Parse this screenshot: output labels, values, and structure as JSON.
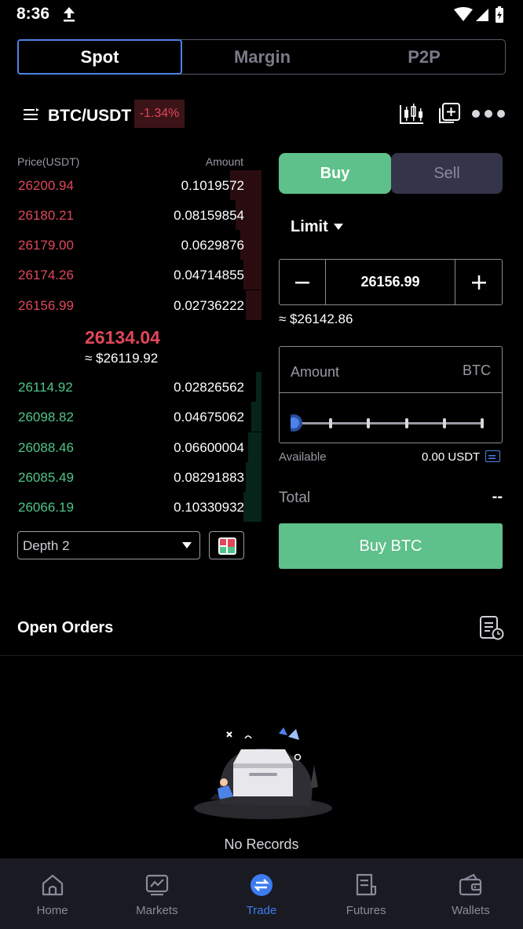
{
  "status_bar": {
    "time": "8:36"
  },
  "segment_tabs": [
    {
      "label": "Spot",
      "active": true
    },
    {
      "label": "Margin",
      "active": false
    },
    {
      "label": "P2P",
      "active": false
    }
  ],
  "pair": {
    "name": "BTC/USDT",
    "change": "-1.34%"
  },
  "orderbook": {
    "price_header": "Price(USDT)",
    "amount_header": "Amount",
    "asks": [
      {
        "price": "26200.94",
        "amount": "0.1019572",
        "depth": 0.12
      },
      {
        "price": "26180.21",
        "amount": "0.08159854",
        "depth": 0.1
      },
      {
        "price": "26179.00",
        "amount": "0.0629876",
        "depth": 0.08
      },
      {
        "price": "26174.26",
        "amount": "0.04714855",
        "depth": 0.07
      },
      {
        "price": "26156.99",
        "amount": "0.02736222",
        "depth": 0.06
      }
    ],
    "mid_price": "26134.04",
    "mid_fiat": "≈ $26119.92",
    "bids": [
      {
        "price": "26114.92",
        "amount": "0.02826562",
        "depth": 0.02
      },
      {
        "price": "26098.82",
        "amount": "0.04675062",
        "depth": 0.04
      },
      {
        "price": "26088.46",
        "amount": "0.06600004",
        "depth": 0.05
      },
      {
        "price": "26085.49",
        "amount": "0.08291883",
        "depth": 0.06
      },
      {
        "price": "26066.19",
        "amount": "0.10330932",
        "depth": 0.07
      }
    ],
    "depth_select": "Depth 2"
  },
  "trade_form": {
    "buy_tab": "Buy",
    "sell_tab": "Sell",
    "order_type": "Limit",
    "price_value": "26156.99",
    "price_fiat": "≈ $26142.86",
    "amount_label": "Amount",
    "amount_unit": "BTC",
    "available_label": "Available",
    "available_value": "0.00 USDT",
    "total_label": "Total",
    "total_value": "--",
    "submit_label": "Buy BTC"
  },
  "open_orders": {
    "title": "Open Orders",
    "empty_text": "No Records"
  },
  "bottom_nav": [
    {
      "label": "Home",
      "icon": "home-icon",
      "active": false
    },
    {
      "label": "Markets",
      "icon": "markets-icon",
      "active": false
    },
    {
      "label": "Trade",
      "icon": "trade-icon",
      "active": true
    },
    {
      "label": "Futures",
      "icon": "futures-icon",
      "active": false
    },
    {
      "label": "Wallets",
      "icon": "wallet-icon",
      "active": false
    }
  ],
  "colors": {
    "ask": "#e0475a",
    "bid": "#4fc489",
    "buy": "#5ec08a",
    "accent": "#3d7cf0"
  }
}
